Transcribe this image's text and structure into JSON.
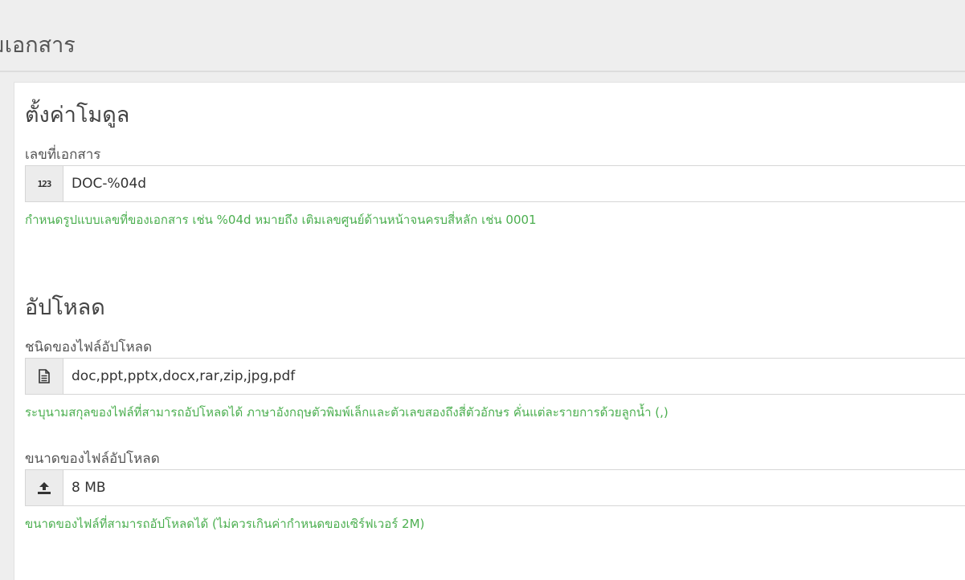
{
  "header": {
    "title": "มเอกสาร"
  },
  "module_settings": {
    "title": "ตั้งค่าโมดูล",
    "doc_number": {
      "label": "เลขที่เอกสาร",
      "icon": "numbers-icon",
      "icon_glyph": "123",
      "value": "DOC-%04d",
      "hint": "กำหนดรูปแบบเลขที่ของเอกสาร เช่น %04d หมายถึง เติมเลขศูนย์ด้านหน้าจนครบสี่หลัก เช่น 0001"
    }
  },
  "upload": {
    "title": "อัปโหลด",
    "file_types": {
      "label": "ชนิดของไฟล์อัปโหลด",
      "icon": "file-icon",
      "value": "doc,ppt,pptx,docx,rar,zip,jpg,pdf",
      "hint": "ระบุนามสกุลของไฟล์ที่สามารถอัปโหลดได้ ภาษาอังกฤษตัวพิมพ์เล็กและตัวเลขสองถึงสี่ตัวอักษร คั่นแต่ละรายการด้วยลูกน้ำ (,)"
    },
    "file_size": {
      "label": "ขนาดของไฟล์อัปโหลด",
      "icon": "upload-icon",
      "value": "8 MB",
      "hint": "ขนาดของไฟล์ที่สามารถอัปโหลดได้ (ไม่ควรเกินค่ากำหนดของเซิร์ฟเวอร์ 2M)"
    }
  },
  "colors": {
    "hint": "#4caf50",
    "background": "#eeeeee",
    "panel": "#ffffff"
  }
}
